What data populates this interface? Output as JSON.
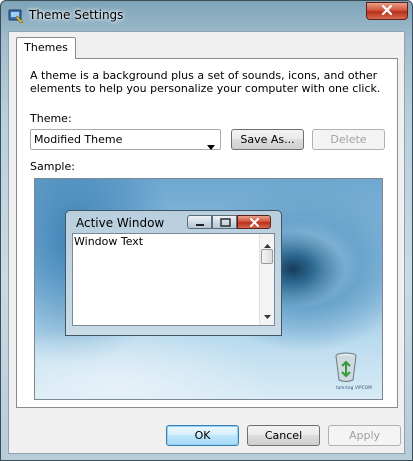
{
  "window": {
    "title": "Theme Settings"
  },
  "tabs": [
    {
      "label": "Themes"
    }
  ],
  "themes_tab": {
    "description": "A theme is a background plus a set of sounds, icons, and other elements to help you personalize your computer with one click.",
    "theme_label": "Theme:",
    "selected_theme": "Modified Theme",
    "save_as_label": "Save As...",
    "delete_label": "Delete",
    "sample_label": "Sample:"
  },
  "sample": {
    "active_window_title": "Active Window",
    "window_text": "Window Text",
    "watermark": "tamrtag VIPCOM"
  },
  "buttons": {
    "ok": "OK",
    "cancel": "Cancel",
    "apply": "Apply"
  },
  "icons": {
    "app": "theme-settings-icon",
    "close": "close-icon",
    "dropdown": "chevron-down-icon",
    "recycle_bin": "recycle-bin-icon"
  },
  "colors": {
    "close_red": "#c23d25",
    "default_button_blue": "#3c7fb1",
    "disabled_text": "#a0a0a0"
  }
}
